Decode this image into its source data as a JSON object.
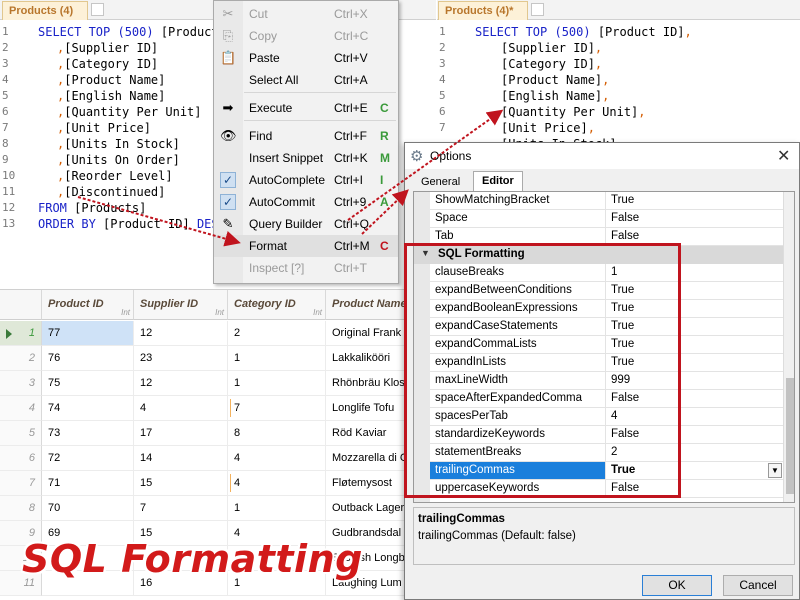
{
  "left_tab": {
    "title": "Products (4)"
  },
  "right_tab": {
    "title": "Products (4)*"
  },
  "editor_line_numbers": [
    "1",
    "2",
    "3",
    "4",
    "5",
    "6",
    "7",
    "8",
    "9",
    "10",
    "11",
    "12",
    "13"
  ],
  "left_code": {
    "l1_kw": "SELECT TOP ",
    "l1_num": "(500)",
    "l1_rest": " [Product",
    "cols": [
      "[Supplier ID]",
      "[Category ID]",
      "[Product Name]",
      "[English Name]",
      "[Quantity Per Unit]",
      "[Unit Price]",
      "[Units In Stock]",
      "[Units On Order]",
      "[Reorder Level]",
      "[Discontinued]"
    ],
    "comma": ",",
    "l12_kw": "FROM",
    "l12_rest": " [Products]",
    "l13_kw": "ORDER BY",
    "l13_rest": " [Product ID] ",
    "l13_kw2": "DES"
  },
  "right_code": {
    "l1_kw": "SELECT TOP ",
    "l1_num": "(500)",
    "l1_rest": " [Product ID]",
    "cols": [
      "[Supplier ID]",
      "[Category ID]",
      "[Product Name]",
      "[English Name]",
      "[Quantity Per Unit]",
      "[Unit Price]",
      "[Units In Stock]"
    ],
    "comma": ","
  },
  "grid": {
    "headers": [
      "Product ID",
      "Supplier ID",
      "Category ID",
      "Product Name"
    ],
    "type_label": "Int",
    "rows": [
      {
        "n": "1",
        "c": [
          "77",
          "12",
          "2",
          "Original Frank"
        ]
      },
      {
        "n": "2",
        "c": [
          "76",
          "23",
          "1",
          "Lakkalikööri"
        ]
      },
      {
        "n": "3",
        "c": [
          "75",
          "12",
          "1",
          "Rhönbräu Klos"
        ]
      },
      {
        "n": "4",
        "c": [
          "74",
          "4",
          "7",
          "Longlife Tofu"
        ]
      },
      {
        "n": "5",
        "c": [
          "73",
          "17",
          "8",
          "Röd Kaviar"
        ]
      },
      {
        "n": "6",
        "c": [
          "72",
          "14",
          "4",
          "Mozzarella di G"
        ]
      },
      {
        "n": "7",
        "c": [
          "71",
          "15",
          "4",
          "Fløtemysost"
        ]
      },
      {
        "n": "8",
        "c": [
          "70",
          "7",
          "1",
          "Outback Lager"
        ]
      },
      {
        "n": "9",
        "c": [
          "69",
          "15",
          "4",
          "Gudbrandsdal"
        ]
      },
      {
        "n": "10",
        "c": [
          "",
          "",
          "",
          "Scottish Longb"
        ]
      },
      {
        "n": "11",
        "c": [
          "",
          "16",
          "1",
          "Laughing Lum"
        ]
      }
    ]
  },
  "context_menu": {
    "items": [
      {
        "label": "Cut",
        "shortcut": "Ctrl+X",
        "icon": "✂",
        "disabled": true
      },
      {
        "label": "Copy",
        "shortcut": "Ctrl+C",
        "icon": "⎘",
        "disabled": true
      },
      {
        "label": "Paste",
        "shortcut": "Ctrl+V",
        "icon": "📋"
      },
      {
        "label": "Select All",
        "shortcut": "Ctrl+A",
        "icon": ""
      },
      {
        "label": "Execute",
        "shortcut": "Ctrl+E",
        "icon": "➡",
        "accel": "C"
      },
      {
        "label": "Find",
        "shortcut": "Ctrl+F",
        "icon": "👁",
        "accel": "R"
      },
      {
        "label": "Insert Snippet",
        "shortcut": "Ctrl+K",
        "icon": "",
        "accel": "M"
      },
      {
        "label": "AutoComplete",
        "shortcut": "Ctrl+I",
        "icon": "✓",
        "accel": "I",
        "checked": true
      },
      {
        "label": "AutoCommit",
        "shortcut": "Ctrl+9",
        "icon": "✓",
        "accel": "A",
        "checked": true
      },
      {
        "label": "Query Builder",
        "shortcut": "Ctrl+Q",
        "icon": "✎"
      },
      {
        "label": "Format",
        "shortcut": "Ctrl+M",
        "icon": "",
        "accel": "C",
        "active": true
      },
      {
        "label": "Inspect [?]",
        "shortcut": "Ctrl+T",
        "icon": "",
        "disabled": true
      }
    ]
  },
  "options_dialog": {
    "title": "Options",
    "tabs": [
      "General",
      "Editor"
    ],
    "top_rows": [
      {
        "name": "ShowMatchingBracket",
        "value": "True"
      },
      {
        "name": "Space",
        "value": "False"
      },
      {
        "name": "Tab",
        "value": "False"
      }
    ],
    "category": "SQL Formatting",
    "rows": [
      {
        "name": "clauseBreaks",
        "value": "1"
      },
      {
        "name": "expandBetweenConditions",
        "value": "True"
      },
      {
        "name": "expandBooleanExpressions",
        "value": "True"
      },
      {
        "name": "expandCaseStatements",
        "value": "True"
      },
      {
        "name": "expandCommaLists",
        "value": "True"
      },
      {
        "name": "expandInLists",
        "value": "True"
      },
      {
        "name": "maxLineWidth",
        "value": "999"
      },
      {
        "name": "spaceAfterExpandedComma",
        "value": "False"
      },
      {
        "name": "spacesPerTab",
        "value": "4"
      },
      {
        "name": "standardizeKeywords",
        "value": "False"
      },
      {
        "name": "statementBreaks",
        "value": "2"
      },
      {
        "name": "trailingCommas",
        "value": "True",
        "selected": true
      },
      {
        "name": "uppercaseKeywords",
        "value": "False"
      }
    ],
    "description_title": "trailingCommas",
    "description_text": "trailingCommas (Default: false)",
    "ok_label": "OK",
    "cancel_label": "Cancel"
  },
  "caption": "SQL Formatting",
  "colors": {
    "highlight": "#c0141e",
    "caption": "#d21a1a",
    "keyword": "#1a23c8",
    "comma": "#d45c00",
    "selection": "#1a7fdc"
  }
}
